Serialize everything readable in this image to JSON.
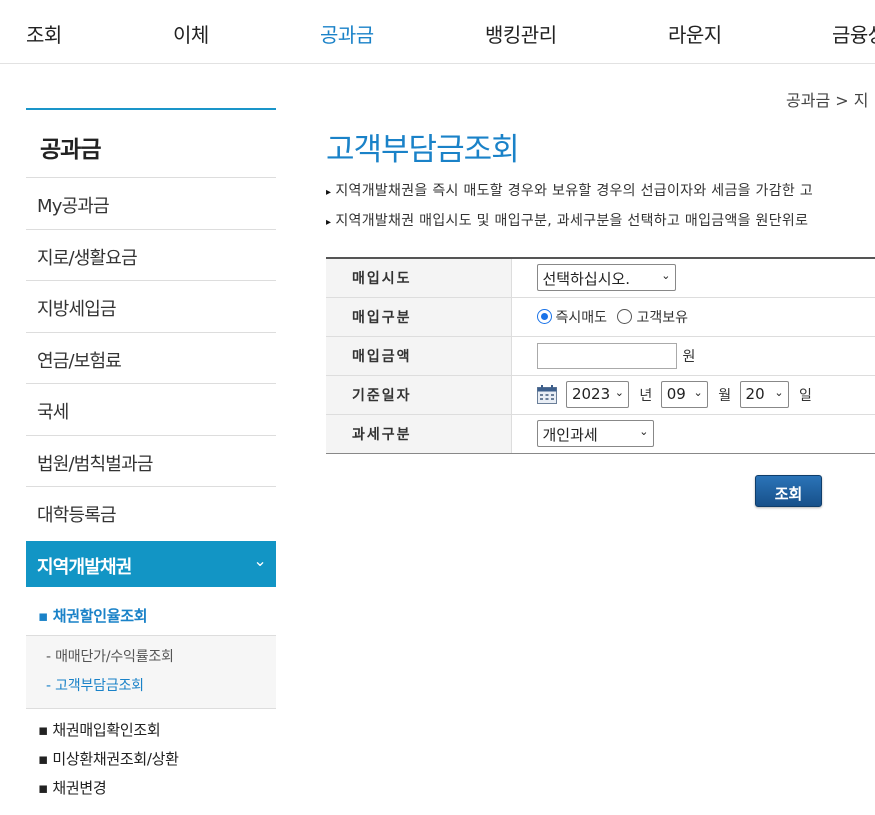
{
  "nav": {
    "items": [
      {
        "label": "조회"
      },
      {
        "label": "이체"
      },
      {
        "label": "공과금"
      },
      {
        "label": "뱅킹관리"
      },
      {
        "label": "라운지"
      },
      {
        "label": "금융상"
      }
    ],
    "active_index": 2
  },
  "breadcrumb": "공과금 > 지",
  "sidebar": {
    "title": "공과금",
    "items": [
      {
        "label": "My공과금"
      },
      {
        "label": "지로/생활요금"
      },
      {
        "label": "지방세입금"
      },
      {
        "label": "연금/보험료"
      },
      {
        "label": "국세"
      },
      {
        "label": "법원/범칙벌과금"
      },
      {
        "label": "대학등록금"
      }
    ],
    "active": {
      "label": "지역개발채권",
      "chevron": "⌄"
    },
    "sub_active": "▪ 채권할인율조회",
    "leaves": [
      {
        "label": "- 매매단가/수익률조회"
      },
      {
        "label": "- 고객부담금조회"
      }
    ],
    "subs": [
      {
        "label": "▪ 채권매입확인조회"
      },
      {
        "label": "▪ 미상환채권조회/상환"
      },
      {
        "label": "▪ 채권변경"
      }
    ]
  },
  "main": {
    "title": "고객부담금조회",
    "desc1": "지역개발채권을 즉시 매도할 경우와 보유할 경우의 선급이자와 세금을 가감한 고",
    "desc2": "지역개발채권 매입시도 및 매입구분, 과세구분을 선택하고 매입금액을 원단위로",
    "form": {
      "region_label": "매입시도",
      "region_value": "선택하십시오.",
      "type_label": "매입구분",
      "type_opt1": "즉시매도",
      "type_opt2": "고객보유",
      "amount_label": "매입금액",
      "amount_value": "",
      "amount_unit": "원",
      "date_label": "기준일자",
      "year": "2023",
      "year_unit": "년",
      "month": "09",
      "month_unit": "월",
      "day": "20",
      "day_unit": "일",
      "tax_label": "과세구분",
      "tax_value": "개인과세"
    },
    "search_button": "조회"
  }
}
